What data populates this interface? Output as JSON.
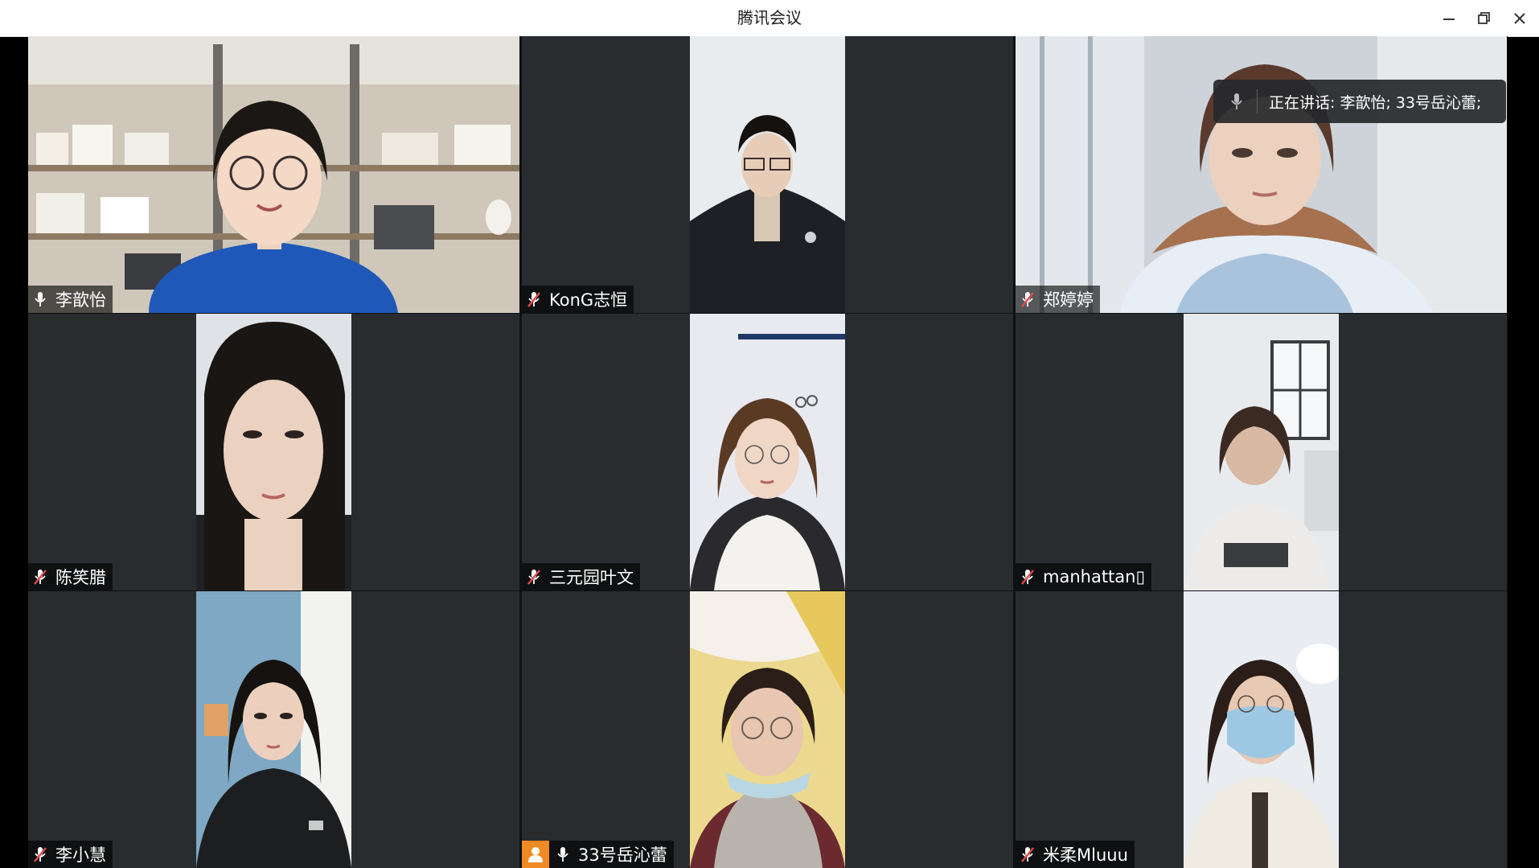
{
  "window": {
    "title": "腾讯会议",
    "controls": [
      "minimize-icon",
      "restore-icon",
      "close-icon"
    ]
  },
  "speaking_indicator": {
    "text": "正在讲话: 李歆怡; 33号岳沁蕾;"
  },
  "participants": [
    {
      "name": "李歆怡",
      "mic": "on",
      "active_speaker": true
    },
    {
      "name": "KonG志恒",
      "mic": "muted"
    },
    {
      "name": "郑婷婷",
      "mic": "muted"
    },
    {
      "name": "陈笑腊",
      "mic": "muted"
    },
    {
      "name": "三元园叶文",
      "mic": "muted"
    },
    {
      "name": "manhattan▯",
      "mic": "muted"
    },
    {
      "name": "李小慧",
      "mic": "muted"
    },
    {
      "name": "33号岳沁蕾",
      "mic": "on",
      "host": true
    },
    {
      "name": "米柔Mluuu",
      "mic": "muted"
    }
  ],
  "colors": {
    "active_border": "#21b46b",
    "tile_bg": "#292c2f",
    "host_badge": "#f08a24",
    "muted_icon": "#e24b4b"
  }
}
